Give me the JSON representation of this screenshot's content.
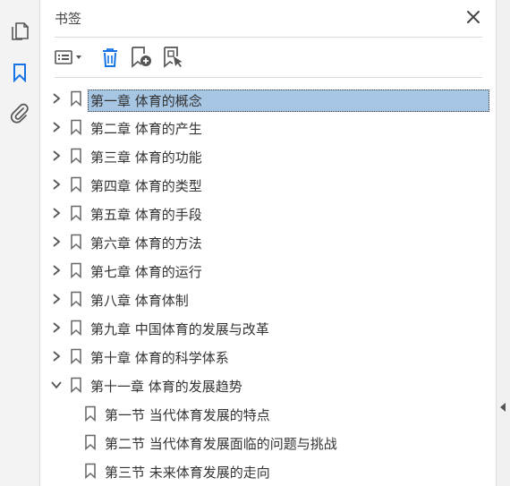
{
  "panel": {
    "title": "书签"
  },
  "icons": {
    "rail": [
      "pages-icon",
      "bookmark-icon",
      "attachment-icon"
    ],
    "toolbar": [
      "options-menu-icon",
      "delete-icon",
      "new-bookmark-icon",
      "new-bookmark-from-structure-icon"
    ],
    "close": "close-icon"
  },
  "colors": {
    "accent": "#1473e6",
    "selection": "#a7c6e3",
    "icon_gray": "#555555"
  },
  "bookmarks": [
    {
      "label": "第一章  体育的概念",
      "level": 0,
      "expanded": false,
      "selected": true
    },
    {
      "label": "第二章  体育的产生",
      "level": 0,
      "expanded": false,
      "selected": false
    },
    {
      "label": "第三章  体育的功能",
      "level": 0,
      "expanded": false,
      "selected": false
    },
    {
      "label": "第四章  体育的类型",
      "level": 0,
      "expanded": false,
      "selected": false
    },
    {
      "label": "第五章  体育的手段",
      "level": 0,
      "expanded": false,
      "selected": false
    },
    {
      "label": "第六章  体育的方法",
      "level": 0,
      "expanded": false,
      "selected": false
    },
    {
      "label": "第七章  体育的运行",
      "level": 0,
      "expanded": false,
      "selected": false
    },
    {
      "label": "第八章  体育体制",
      "level": 0,
      "expanded": false,
      "selected": false
    },
    {
      "label": "第九章  中国体育的发展与改革",
      "level": 0,
      "expanded": false,
      "selected": false
    },
    {
      "label": "第十章  体育的科学体系",
      "level": 0,
      "expanded": false,
      "selected": false
    },
    {
      "label": "第十一章  体育的发展趋势",
      "level": 0,
      "expanded": true,
      "selected": false
    },
    {
      "label": "第一节  当代体育发展的特点",
      "level": 1,
      "selected": false
    },
    {
      "label": "第二节  当代体育发展面临的问题与挑战",
      "level": 1,
      "selected": false
    },
    {
      "label": "第三节  未来体育发展的走向",
      "level": 1,
      "selected": false
    }
  ]
}
